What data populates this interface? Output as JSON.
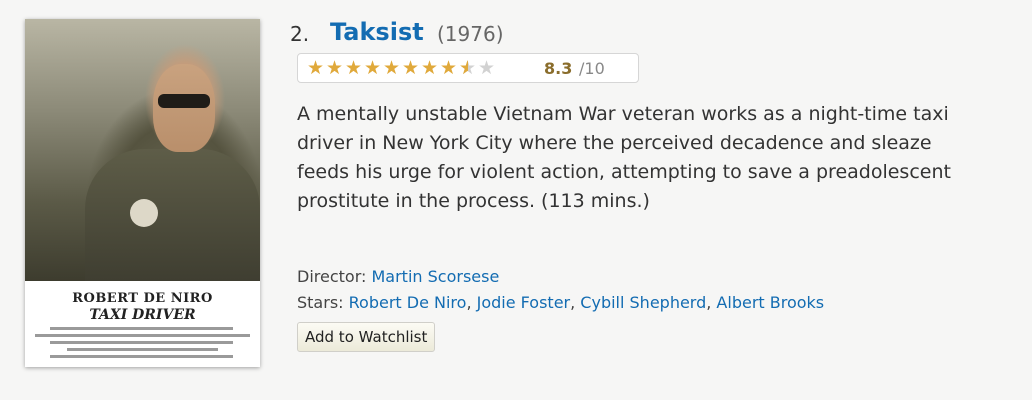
{
  "movie": {
    "rank": "2.",
    "title": "Taksist",
    "year": "(1976)",
    "rating": {
      "value": "8.3",
      "max": "/10",
      "stars_filled": 8.3,
      "stars_total": 10,
      "star_color": "#e0a93b"
    },
    "outline": "A mentally unstable Vietnam War veteran works as a night-time taxi driver in New York City where the perceived decadence and sleaze feeds his urge for violent action, attempting to save a preadolescent prostitute in the process. (113 mins.)",
    "director_label": "Director:",
    "director": "Martin Scorsese",
    "stars_label": "Stars:",
    "stars": [
      "Robert De Niro",
      "Jodie Foster",
      "Cybill Shepherd",
      "Albert Brooks"
    ],
    "watchlist_label": "Add to Watchlist",
    "poster": {
      "actor": "ROBERT DE NIRO",
      "title": "TAXI DRIVER"
    },
    "link_color": "#136cb2"
  }
}
